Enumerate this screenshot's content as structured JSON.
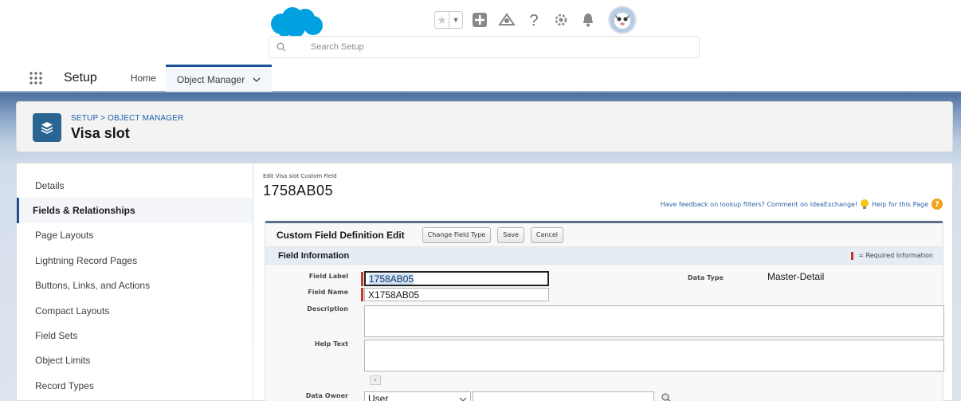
{
  "header": {
    "search_placeholder": "Search Setup",
    "brand_color": "#00a1e0"
  },
  "nav": {
    "app_name": "Setup",
    "tabs": [
      {
        "label": "Home"
      },
      {
        "label": "Object Manager"
      }
    ]
  },
  "object": {
    "breadcrumb": "SETUP > OBJECT MANAGER",
    "title": "Visa slot"
  },
  "sidebar": {
    "items": [
      {
        "label": "Details"
      },
      {
        "label": "Fields & Relationships"
      },
      {
        "label": "Page Layouts"
      },
      {
        "label": "Lightning Record Pages"
      },
      {
        "label": "Buttons, Links, and Actions"
      },
      {
        "label": "Compact Layouts"
      },
      {
        "label": "Field Sets"
      },
      {
        "label": "Object Limits"
      },
      {
        "label": "Record Types"
      }
    ],
    "active_index": 1
  },
  "main": {
    "subtitle": "Edit Visa slot Custom Field",
    "title": "1758AB05",
    "feedback_link": "Have feedback on lookup filters? Comment on IdeaExchange!",
    "help_link": "Help for this Page",
    "section": {
      "title": "Custom Field Definition Edit",
      "buttons": {
        "change_type": "Change Field Type",
        "save": "Save",
        "cancel": "Cancel"
      },
      "subsection_title": "Field Information",
      "required_legend": "= Required Information",
      "fields": {
        "field_label": {
          "label": "Field Label",
          "value": "1758AB05"
        },
        "field_name": {
          "label": "Field Name",
          "value": "X1758AB05"
        },
        "description": {
          "label": "Description"
        },
        "help_text": {
          "label": "Help Text"
        },
        "data_owner": {
          "label": "Data Owner",
          "value": "User"
        },
        "data_type": {
          "label": "Data Type",
          "value": "Master-Detail"
        }
      }
    }
  }
}
